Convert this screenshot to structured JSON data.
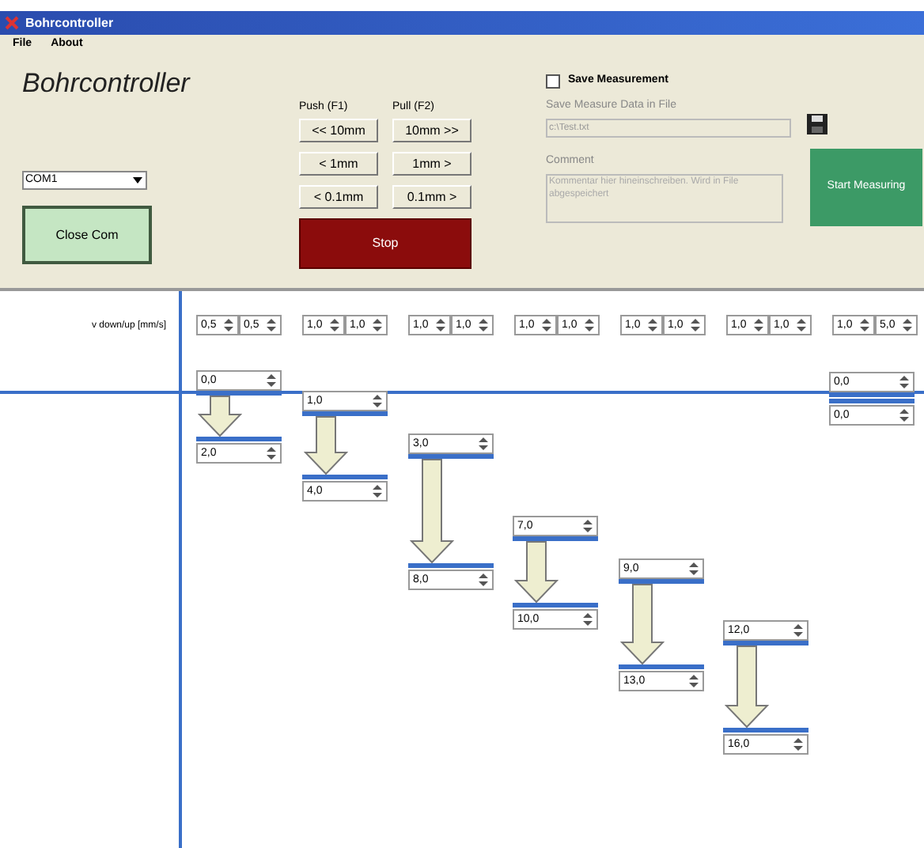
{
  "window": {
    "title": "Bohrcontroller"
  },
  "menu": [
    "File",
    "About"
  ],
  "app_title": "Bohrcontroller",
  "port": {
    "value": "COM1"
  },
  "close_button": "Close Com",
  "jog": {
    "push_label": "Push (F1)",
    "pull_label": "Pull (F2)",
    "push_buttons": [
      "<< 10mm",
      "< 1mm",
      "< 0.1mm"
    ],
    "pull_buttons": [
      "10mm >>",
      "1mm >",
      "0.1mm >"
    ],
    "stop": "Stop"
  },
  "save": {
    "label": "Save Measurement",
    "checked": false,
    "file_label": "Save Measure Data in File",
    "file_value": "c:\\Test.txt",
    "comment_label": "Comment",
    "comment_placeholder": "Kommentar hier hineinschreiben. Wird in File abgespeichert"
  },
  "start_button": "Start Measuring",
  "speed_label": "v down/up [mm/s]",
  "steps": [
    {
      "speeds": [
        "0,5",
        "0,5"
      ],
      "from": "0,0",
      "to": "2,0",
      "arrow": true
    },
    {
      "speeds": [
        "1,0",
        "1,0"
      ],
      "from": "1,0",
      "to": "4,0",
      "arrow": true
    },
    {
      "speeds": [
        "1,0",
        "1,0"
      ],
      "from": "3,0",
      "to": "8,0",
      "arrow": true
    },
    {
      "speeds": [
        "1,0",
        "1,0"
      ],
      "from": "7,0",
      "to": "10,0",
      "arrow": true
    },
    {
      "speeds": [
        "1,0",
        "1,0"
      ],
      "from": "9,0",
      "to": "13,0",
      "arrow": true
    },
    {
      "speeds": [
        "1,0",
        "1,0"
      ],
      "from": "12,0",
      "to": "16,0",
      "arrow": true
    },
    {
      "speeds": [
        "1,0",
        "5,0"
      ],
      "from": "0,0",
      "to": "0,0",
      "arrow": false
    }
  ]
}
